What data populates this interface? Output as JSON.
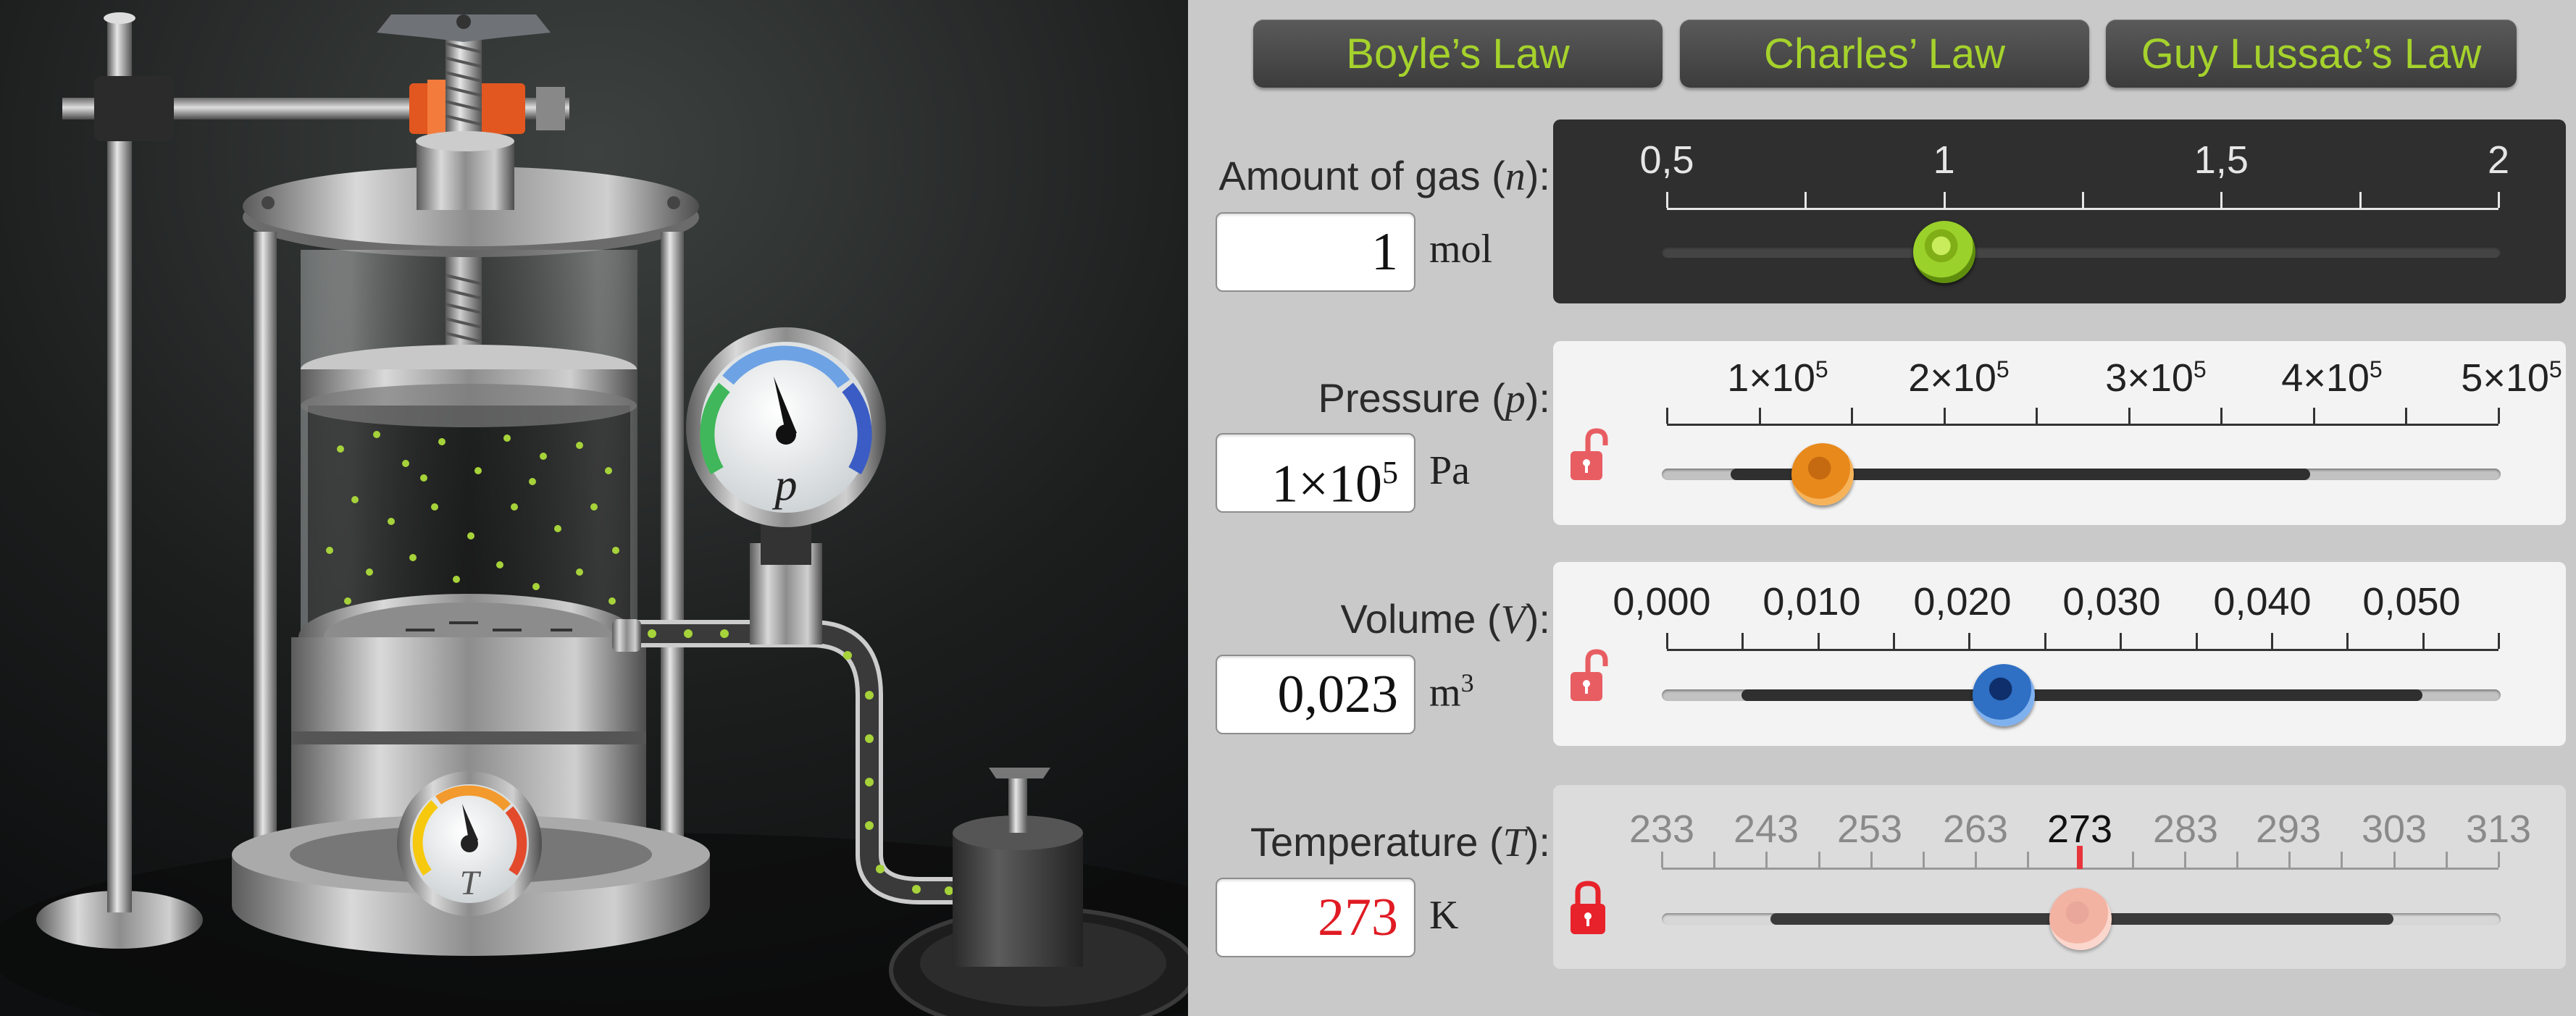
{
  "laws": {
    "boyle": "Boyle’s Law",
    "charles": "Charles’ Law",
    "gay_lussac": "Guy Lussac’s Law"
  },
  "amount": {
    "label_text": "Amount of gas",
    "symbol": "n",
    "value": "1",
    "unit": "mol",
    "ticks": [
      "0,5",
      "1",
      "1,5",
      "2"
    ],
    "slider_value": 1,
    "range": [
      0.5,
      2
    ]
  },
  "pressure": {
    "label_text": "Pressure",
    "symbol": "p",
    "value": "1×10",
    "value_exp": "5",
    "unit": "Pa",
    "tick_base": "×10",
    "tick_exp": "5",
    "ticks": [
      "1",
      "2",
      "3",
      "4",
      "5"
    ],
    "slider_value": 100000,
    "range": [
      50000,
      500000
    ],
    "lock_state": "unlocked"
  },
  "volume": {
    "label_text": "Volume",
    "symbol": "V",
    "value": "0,023",
    "unit": "m",
    "unit_exp": "3",
    "ticks": [
      "0,000",
      "0,010",
      "0,020",
      "0,030",
      "0,040",
      "0,050"
    ],
    "slider_value": 0.023,
    "lock_state": "unlocked"
  },
  "temperature": {
    "label_text": "Temperature",
    "symbol": "T",
    "value": "273",
    "unit": "K",
    "ticks": [
      "233",
      "243",
      "253",
      "263",
      "273",
      "283",
      "293",
      "303",
      "313"
    ],
    "highlight_tick": "273",
    "slider_value": 273,
    "lock_state": "locked"
  },
  "gauges": {
    "pressure_symbol": "p",
    "temperature_symbol": "T"
  },
  "colors": {
    "accent_green": "#a5d22c",
    "pressure_knob": "#e8891c",
    "volume_knob": "#2f6fc4",
    "temperature_knob": "#f2b3a3",
    "lock_red": "#e8343b",
    "molecule": "#a6d23a"
  }
}
